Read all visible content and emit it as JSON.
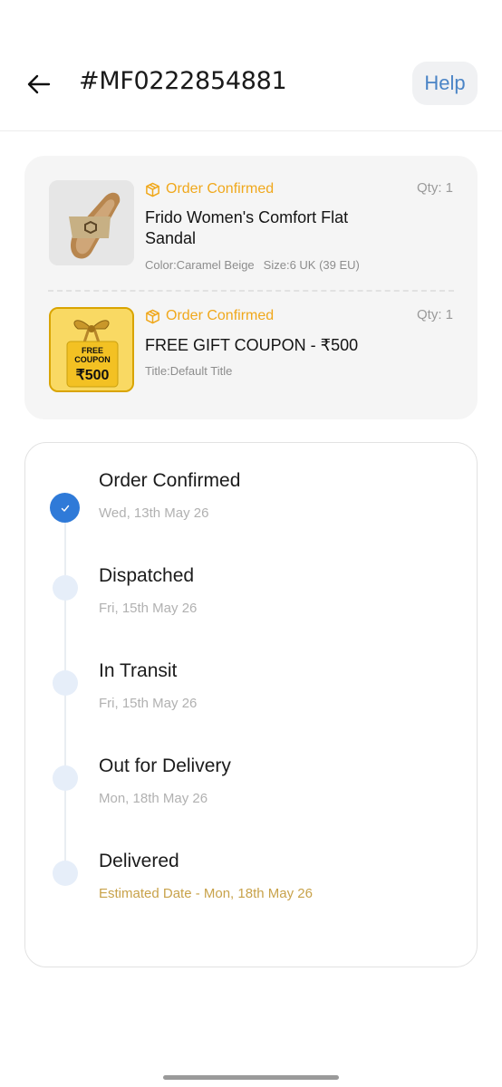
{
  "header": {
    "order_id": "#MF0222854881",
    "help_label": "Help"
  },
  "items": [
    {
      "status": "Order Confirmed",
      "qty": "Qty: 1",
      "name": "Frido Women's Comfort Flat Sandal",
      "color": "Color:Caramel Beige",
      "size": "Size:6 UK (39 EU)",
      "image": "sandal-image"
    },
    {
      "status": "Order Confirmed",
      "qty": "Qty: 1",
      "name": "FREE GIFT COUPON - ₹500",
      "title": "Title:Default Title",
      "image": "gift-coupon-image",
      "coupon_text_1": "FREE",
      "coupon_text_2": "COUPON",
      "coupon_amount": "₹500"
    }
  ],
  "timeline": [
    {
      "title": "Order Confirmed",
      "date": "Wed, 13th May 26",
      "done": true
    },
    {
      "title": "Dispatched",
      "date": "Fri, 15th May 26",
      "done": false
    },
    {
      "title": "In Transit",
      "date": "Fri, 15th May 26",
      "done": false
    },
    {
      "title": "Out for Delivery",
      "date": "Mon, 18th May 26",
      "done": false
    },
    {
      "title": "Delivered",
      "date": "Estimated Date - Mon, 18th May 26",
      "done": false
    }
  ],
  "colors": {
    "accent_blue": "#2f7ad8",
    "status_orange": "#f0a81c",
    "estimate_gold": "#c8a24a"
  }
}
